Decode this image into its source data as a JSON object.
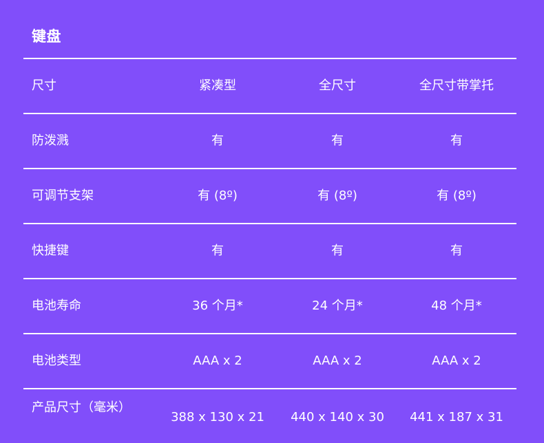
{
  "section": {
    "title": "键盘"
  },
  "rows": [
    {
      "label": "尺寸",
      "values": [
        "紧凑型",
        "全尺寸",
        "全尺寸带掌托"
      ]
    },
    {
      "label": "防泼溅",
      "values": [
        "有",
        "有",
        "有"
      ]
    },
    {
      "label": "可调节支架",
      "values": [
        "有 (8º)",
        "有 (8º)",
        "有 (8º)"
      ]
    },
    {
      "label": "快捷键",
      "values": [
        "有",
        "有",
        "有"
      ]
    },
    {
      "label": "电池寿命",
      "values": [
        "36 个月*",
        "24 个月*",
        "48 个月*"
      ]
    },
    {
      "label": "电池类型",
      "values": [
        "AAA x 2",
        "AAA x 2",
        "AAA x 2"
      ]
    },
    {
      "label": "产品尺寸（毫米）",
      "values": [
        "388 x 130 x 21",
        "440 x 140 x 30",
        "441 x 187 x 31"
      ]
    }
  ]
}
